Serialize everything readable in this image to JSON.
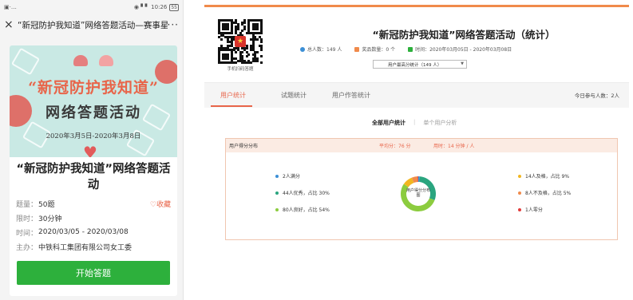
{
  "phone": {
    "status_left": "▣·…",
    "status_right": "◉ ▘▘ 10:26",
    "battery": "55",
    "nav_title": "“新冠防护我知道”网络答题活动—赛事星",
    "close_icon": "close-icon",
    "more_icon": "more-icon",
    "banner": {
      "title1": "“新冠防护我知道”",
      "title2": "网络答题活动",
      "date": "2020年3月5日-2020年3月8日"
    },
    "quiz_title": "“新冠防护我知道”网络答题活动",
    "meta": {
      "count_label": "题量：",
      "count_value": "50题",
      "favorite": "♡收藏",
      "time_label": "限时：",
      "time_value": "30分钟",
      "date_label": "时间：",
      "date_value": "2020/03/05 - 2020/03/08",
      "host_label": "主办：",
      "host_value": "中铁科工集团有限公司女工委"
    },
    "start_button": "开始答题"
  },
  "stats": {
    "qr_caption": "手机扫码答题",
    "title": "“新冠防护我知道”网络答题活动（统计）",
    "total_people": "总人数：149 人",
    "prize_count": "奖品数量：0 个",
    "time_range": "时间：2020年03月05日 - 2020年03月08日",
    "select_value": "用户最高分统计（149 人）",
    "tabs": [
      "用户统计",
      "试题统计",
      "用户作答统计"
    ],
    "today_participants": "今日参与人数：2人",
    "subtab_all": "全部用户统计",
    "subtab_single": "单个用户分析",
    "panel_title": "用户得分分布",
    "avg_score": "平均分：76 分",
    "avg_time": "用时：14 分钟 / 人",
    "donut_label": "用户得分分布图",
    "colors": {
      "accent": "#e8654a",
      "green": "#2db03c",
      "blue": "#3c8fd6",
      "teal": "#2aa57f",
      "lime": "#8ccc3f",
      "yellow": "#f2b620",
      "orange": "#f08a4b",
      "red": "#e23b3b"
    }
  },
  "chart_data": {
    "type": "pie",
    "title": "用户得分分布",
    "categories": [
      "2人满分",
      "44人优秀，占比 30%",
      "80人良好，占比 54%",
      "14人及格，占比 9%",
      "8人不及格，占比 5%",
      "1人零分"
    ],
    "values": [
      2,
      44,
      80,
      14,
      8,
      1
    ],
    "colors": [
      "#3c8fd6",
      "#2aa57f",
      "#8ccc3f",
      "#f2b620",
      "#f08a4b",
      "#e23b3b"
    ]
  }
}
